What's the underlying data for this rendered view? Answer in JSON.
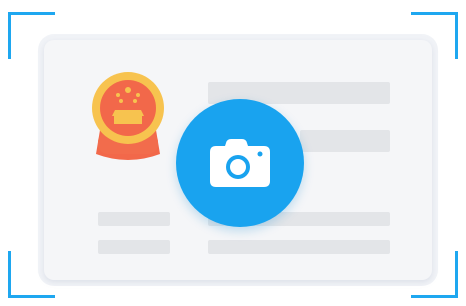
{
  "scanner": {
    "accent_color": "#1ea7f0",
    "card_color": "#f5f6f8",
    "placeholder_color": "#e3e5e8",
    "camera_button_color": "#19a3ef",
    "emblem_colors": [
      "#f7c34f",
      "#f2684a"
    ],
    "icons": [
      "national-emblem-icon",
      "camera-icon"
    ]
  }
}
